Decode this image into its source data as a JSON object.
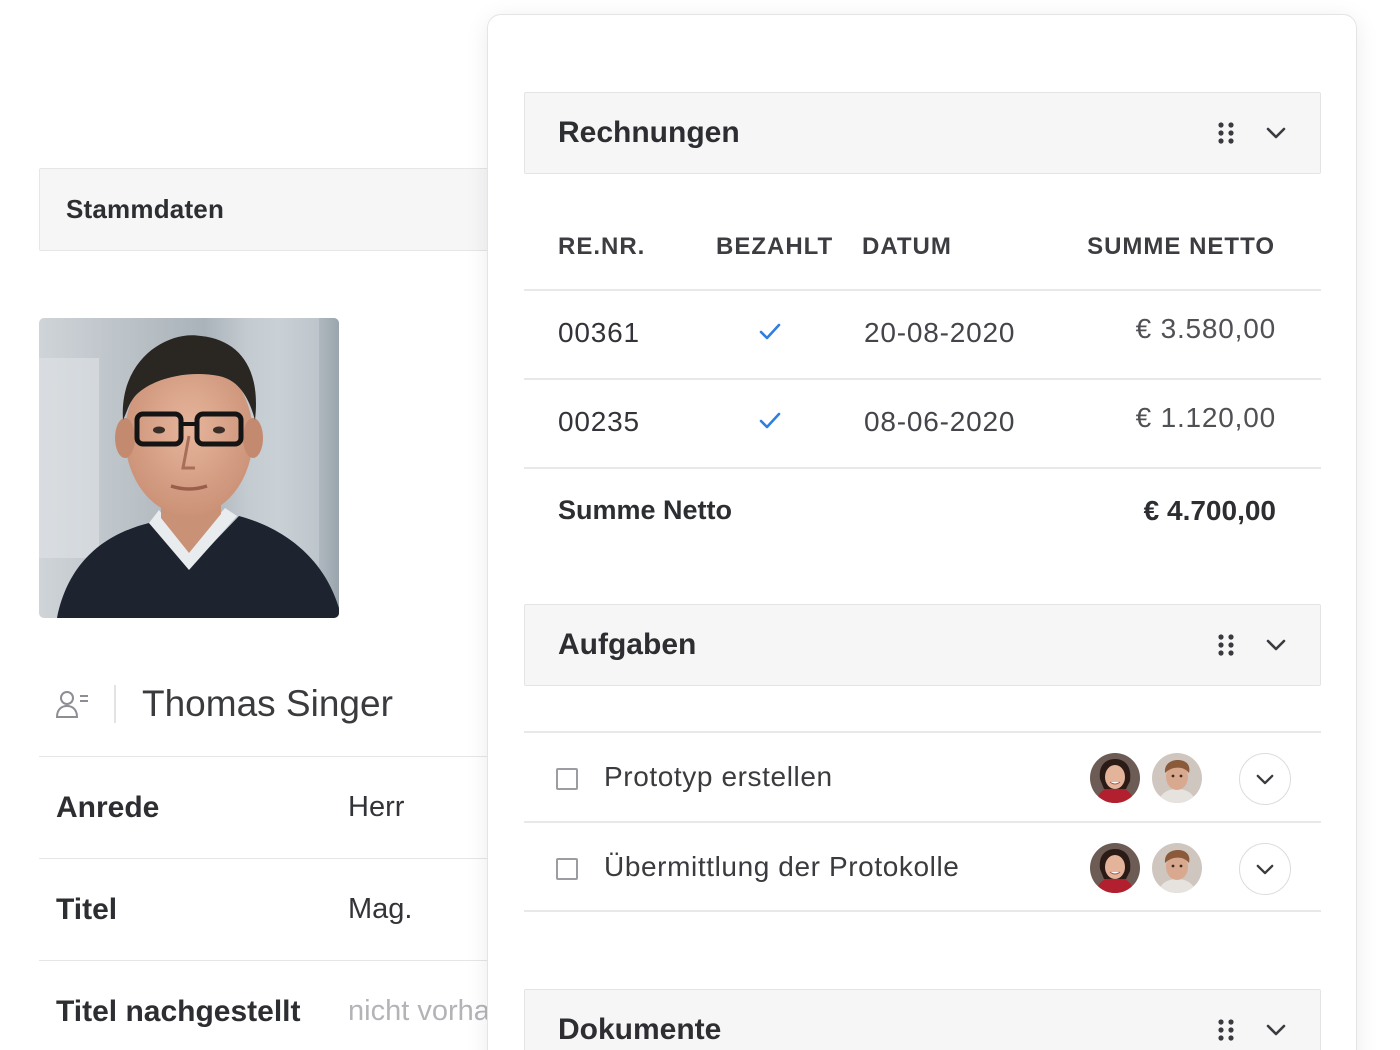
{
  "stammdaten": {
    "title": "Stammdaten",
    "name": "Thomas Singer",
    "fields": [
      {
        "label": "Anrede",
        "value": "Herr"
      },
      {
        "label": "Titel",
        "value": "Mag."
      },
      {
        "label": "Titel nachgestellt",
        "value": "nicht vorhanden"
      }
    ]
  },
  "rechnungen": {
    "title": "Rechnungen",
    "columns": [
      "RE.NR.",
      "BEZAHLT",
      "DATUM",
      "SUMME NETTO"
    ],
    "rows": [
      {
        "nr": "00361",
        "paid": true,
        "date": "20-08-2020",
        "amount": "€ 3.580,00"
      },
      {
        "nr": "00235",
        "paid": true,
        "date": "08-06-2020",
        "amount": "€ 1.120,00"
      }
    ],
    "sum_label": "Summe Netto",
    "sum_value": "€ 4.700,00"
  },
  "aufgaben": {
    "title": "Aufgaben",
    "tasks": [
      {
        "label": "Prototyp erstellen",
        "done": false
      },
      {
        "label": "Übermittlung der Protokolle",
        "done": false
      }
    ]
  },
  "dokumente": {
    "title": "Dokumente"
  },
  "colors": {
    "accent": "#2f7fe0",
    "header_bg": "#f6f6f7",
    "border": "#e4e4e6"
  },
  "icons": {
    "drag": "drag-handle-icon",
    "collapse": "chevron-down-icon",
    "check": "checkmark-icon",
    "person": "person-card-icon"
  }
}
